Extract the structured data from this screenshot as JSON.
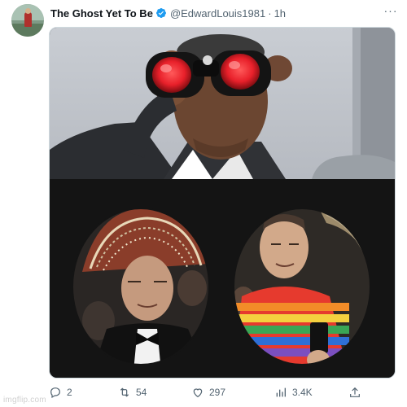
{
  "tweet": {
    "display_name": "The Ghost Yet To Be",
    "handle": "@EdwardLouis1981",
    "separator": "·",
    "time": "1h",
    "more_label": "···"
  },
  "media": {
    "top_image_subject": "man-looking-through-red-binoculars",
    "bottom_image_subject": "two-men-in-binocular-view"
  },
  "actions": {
    "reply_count": "2",
    "retweet_count": "54",
    "like_count": "297",
    "view_count": "3.4K"
  },
  "icons": {
    "reply": "reply-icon",
    "retweet": "retweet-icon",
    "like": "heart-icon",
    "views": "views-icon",
    "share": "share-icon",
    "verified": "verified-badge-icon"
  },
  "colors": {
    "verified_blue": "#1d9bf0",
    "secondary_text": "#536471",
    "binocular_red": "#e8202a"
  },
  "watermark": {
    "text": "imgflip.com"
  }
}
